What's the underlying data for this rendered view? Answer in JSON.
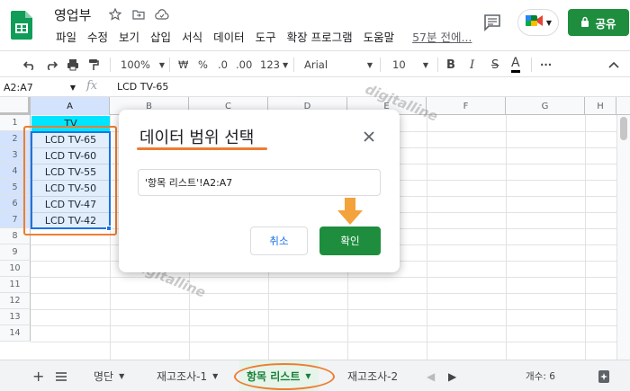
{
  "app": {
    "doc_title": "영업부",
    "menu": [
      "파일",
      "수정",
      "보기",
      "삽입",
      "서식",
      "데이터",
      "도구",
      "확장 프로그램",
      "도움말"
    ],
    "last_edit": "57분 전에...",
    "share_label": "공유",
    "accent_green": "#1e8e3e"
  },
  "toolbar": {
    "zoom": "100%",
    "currency": "₩",
    "percent": "%",
    "dec_decrease": ".0",
    "dec_increase": ".00",
    "number_format": "123",
    "font": "Arial",
    "font_size": "10",
    "bold": "B",
    "italic": "I",
    "strike": "S",
    "text_color": "A",
    "more": "···"
  },
  "formula_bar": {
    "name_box": "A2:A7",
    "fx": "fx",
    "value": "LCD TV-65"
  },
  "grid": {
    "columns": [
      "A",
      "B",
      "C",
      "D",
      "E",
      "F",
      "G",
      "H"
    ],
    "rows": [
      "1",
      "2",
      "3",
      "4",
      "5",
      "6",
      "7",
      "8",
      "9",
      "10",
      "11",
      "12",
      "13",
      "14"
    ],
    "header_cell": "TV",
    "cells": [
      "LCD TV-65",
      "LCD TV-60",
      "LCD TV-55",
      "LCD TV-50",
      "LCD TV-47",
      "LCD TV-42"
    ]
  },
  "watermark": "digitalline",
  "dialog": {
    "title": "데이터 범위 선택",
    "range_value": "'항목 리스트'!A2:A7",
    "cancel_label": "취소",
    "ok_label": "확인"
  },
  "tabs": {
    "items": [
      {
        "label": "명단"
      },
      {
        "label": "재고조사-1"
      },
      {
        "label": "항목 리스트"
      },
      {
        "label": "재고조사-2"
      }
    ],
    "count_label": "개수: 6"
  },
  "colors": {
    "highlight_cyan": "#00e5ff",
    "annotation_orange": "#ed7d31",
    "selection_blue": "#1a73e8"
  }
}
